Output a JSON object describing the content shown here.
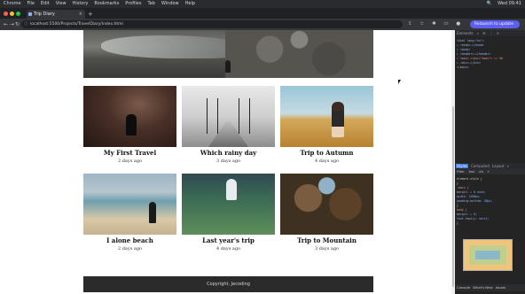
{
  "menubar": {
    "apple": "",
    "items": [
      "Chrome",
      "File",
      "Edit",
      "View",
      "History",
      "Bookmarks",
      "Profiles",
      "Tab",
      "Window",
      "Help"
    ],
    "right": [
      "🔍",
      "Wed 09:41"
    ]
  },
  "browser": {
    "tab_title": "Trip Diary",
    "url": "localhost:5500/Projects/TravelDiary/index.html",
    "profile": "Relaunch to update"
  },
  "page": {
    "footer": "Copyright, Jecoding",
    "posts": [
      {
        "title": "My First Travel",
        "date": "2 days ago"
      },
      {
        "title": "Which rainy day",
        "date": "3 days ago"
      },
      {
        "title": "Trip to Autumn",
        "date": "4 days ago"
      },
      {
        "title": "I alone beach",
        "date": "2 days ago"
      },
      {
        "title": "Last year's trip",
        "date": "4 days ago"
      },
      {
        "title": "Trip to Mountain",
        "date": "3 days ago"
      }
    ]
  },
  "devtools": {
    "top_tabs": [
      "Elements",
      "»",
      "⚙",
      "⋮",
      "✕"
    ],
    "dom_lines": [
      {
        "text": "<html lang=\"en\">",
        "color": "#8ab4f8"
      },
      {
        "text": "▸ <head>…</head>",
        "color": "#8ab4f8"
      },
      {
        "text": "▾ <body>",
        "color": "#8ab4f8"
      },
      {
        "text": "  ▸ <header>…</header>",
        "color": "#8ab4f8"
      },
      {
        "text": "  ▾ <main class=\"main\"> == $0",
        "color": "#f28b82"
      },
      {
        "text": "    ▸ <div>…</div>",
        "color": "#8ab4f8"
      },
      {
        "text": "  </main>",
        "color": "#8ab4f8"
      }
    ],
    "panel_tabs": [
      "Styles",
      "Computed",
      "Layout",
      "»"
    ],
    "sub_tabs": [
      "Filter",
      ":hov",
      ".cls",
      "+"
    ],
    "style_lines": [
      {
        "text": "element.style {",
        "color": "#c7c7c7"
      },
      {
        "text": "}",
        "color": "#c7c7c7"
      },
      {
        "text": ".main {",
        "color": "#f28b82"
      },
      {
        "text": "  margin: ▸ 0 auto;",
        "color": "#8ab4f8"
      },
      {
        "text": "  width: 1200px;",
        "color": "#8ab4f8"
      },
      {
        "text": "  padding-bottom: 40px;",
        "color": "#8ab4f8"
      },
      {
        "text": "}",
        "color": "#c7c7c7"
      },
      {
        "text": "body {",
        "color": "#f28b82"
      },
      {
        "text": "  margin: ▸ 0;",
        "color": "#8ab4f8"
      },
      {
        "text": "  font-family: serif;",
        "color": "#8ab4f8"
      },
      {
        "text": "}",
        "color": "#c7c7c7"
      }
    ],
    "bottom_tabs": [
      "Console",
      "What's New",
      "Issues"
    ]
  }
}
